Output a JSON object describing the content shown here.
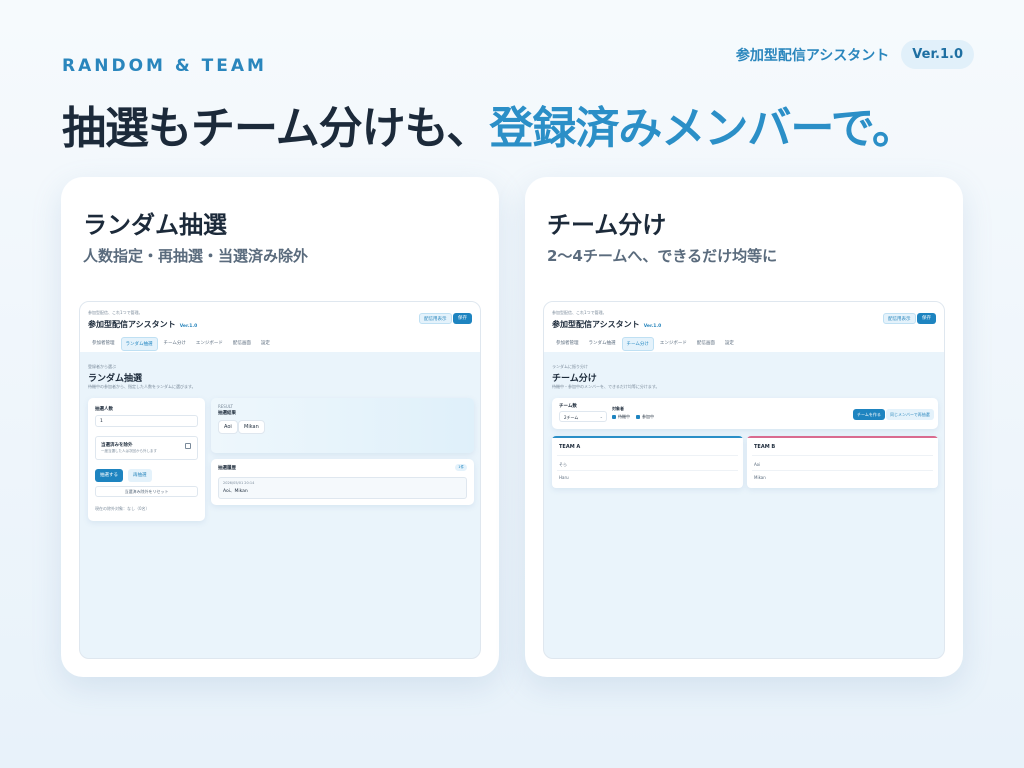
{
  "header": {
    "eyebrow": "RANDOM & TEAM",
    "headline_main": "抽選もチーム分けも、",
    "headline_accent": "登録済みメンバーで。",
    "brand_name": "参加型配信アシスタント",
    "version": "Ver.1.0"
  },
  "cards": {
    "lottery": {
      "title": "ランダム抽選",
      "subtitle": "人数指定・再抽選・当選済み除外",
      "screenshot": {
        "tagline": "参加型配信、これ1つで管理。",
        "app_title": "参加型配信アシスタント",
        "app_version": "Ver.1.0",
        "btn_outline": "配信用表示",
        "btn_solid": "保存",
        "tabs": [
          "参加者管理",
          "ランダム抽選",
          "チーム分け",
          "エンジボード",
          "配信画面",
          "設定"
        ],
        "active_tab": 1,
        "section_label": "登録者から選ぶ",
        "section_title": "ランダム抽選",
        "section_desc": "待機中の参加者から、指定した人数をランダムに選びます。",
        "count_label": "抽選人数",
        "count_value": "1",
        "exclude_label": "当選済みを除外",
        "exclude_desc": "一度当選した人は次回から外します",
        "draw_button": "抽選する",
        "redraw_button": "再抽選",
        "reset_link": "当選済み除外をリセット",
        "footer_note": "現在の除外対象：なし（0名）",
        "result_label": "RESULT",
        "result_title": "抽選結果",
        "results": [
          "Aoi",
          "Mikan"
        ],
        "history_title": "抽選履歴",
        "history_badge": "1件",
        "history_time": "2026/05/01 20:14",
        "history_entry": "Aoi、Mikan"
      }
    },
    "team": {
      "title": "チーム分け",
      "subtitle": "2〜4チームへ、できるだけ均等に",
      "screenshot": {
        "tagline": "参加型配信、これ1つで管理。",
        "app_title": "参加型配信アシスタント",
        "app_version": "Ver.1.0",
        "btn_outline": "配信用表示",
        "btn_solid": "保存",
        "tabs": [
          "参加者管理",
          "ランダム抽選",
          "チーム分け",
          "エンジボード",
          "配信画面",
          "設定"
        ],
        "active_tab": 2,
        "section_label": "ランダムに振り分け",
        "section_title": "チーム分け",
        "section_desc": "待機中・参加中のメンバーを、できるだけ均等に分けます。",
        "team_count_label": "チーム数",
        "team_count_value": "2チーム",
        "target_label": "対象者",
        "target_waiting": "待機中",
        "target_playing": "参加中",
        "make_button": "チームを作る",
        "retry_button": "同じメンバーで再抽選",
        "teams": [
          {
            "name": "TEAM A",
            "members": [
              "そら",
              "Haru"
            ]
          },
          {
            "name": "TEAM B",
            "members": [
              "Aoi",
              "Mikan"
            ]
          }
        ]
      }
    }
  }
}
